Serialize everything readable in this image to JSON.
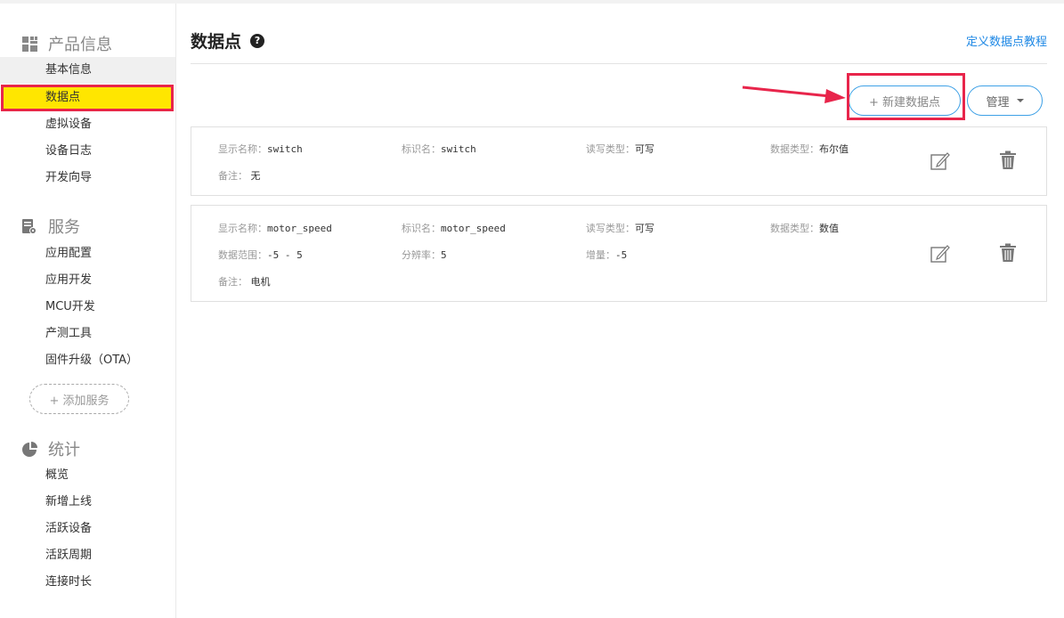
{
  "sidebar": {
    "product_section": {
      "title": "产品信息",
      "icon": "grid-icon"
    },
    "product_items": [
      "基本信息",
      "数据点",
      "虚拟设备",
      "设备日志",
      "开发向导"
    ],
    "service_section": {
      "title": "服务",
      "icon": "server-icon"
    },
    "service_items": [
      "应用配置",
      "应用开发",
      "MCU开发",
      "产测工具",
      "固件升级（OTA）"
    ],
    "add_service": "+ 添加服务",
    "stats_section": {
      "title": "统计",
      "icon": "pie-chart-icon"
    },
    "stats_items": [
      "概览",
      "新增上线",
      "活跃设备",
      "活跃周期",
      "连接时长"
    ]
  },
  "main": {
    "title": "数据点",
    "help_icon": "question-circle-icon",
    "tutorial_link": "定义数据点教程",
    "new_button": "+ 新建数据点",
    "manage_button": "管理"
  },
  "datapoints": [
    {
      "display_name_label": "显示名称：",
      "display_name": "switch",
      "identifier_label": "标识名：",
      "identifier": "switch",
      "rw_label": "读写类型：",
      "rw": "可写",
      "dtype_label": "数据类型：",
      "dtype": "布尔值",
      "remark_label": "备注：",
      "remark": "无"
    },
    {
      "display_name_label": "显示名称：",
      "display_name": "motor_speed",
      "identifier_label": "标识名：",
      "identifier": "motor_speed",
      "rw_label": "读写类型：",
      "rw": "可写",
      "dtype_label": "数据类型：",
      "dtype": "数值",
      "range_label": "数据范围：",
      "range": "-5 - 5",
      "resolution_label": "分辨率：",
      "resolution": "5",
      "increment_label": "增量：",
      "increment": "-5",
      "remark_label": "备注：",
      "remark": "电机"
    }
  ],
  "colors": {
    "accent": "#3fa1e6",
    "link": "#1e88e5",
    "highlight": "#e8254b",
    "active_bg": "#ffe600"
  }
}
